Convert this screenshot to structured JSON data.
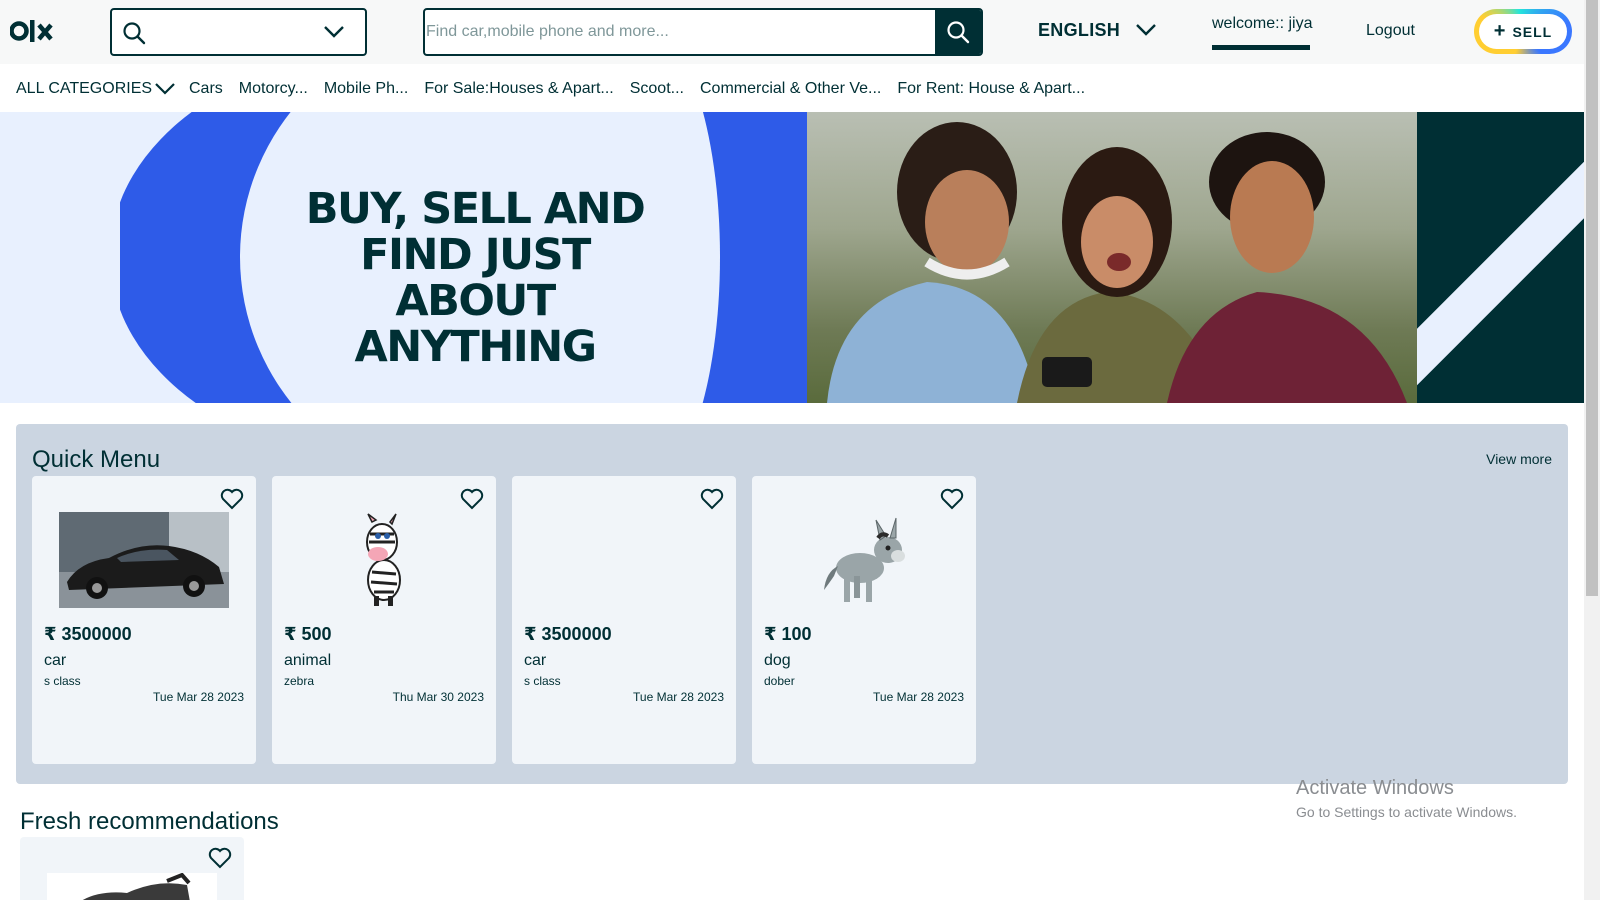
{
  "header": {
    "logo_text": "OLX",
    "location_value": "",
    "search_placeholder": "Find car,mobile phone and more...",
    "language": "ENGLISH",
    "welcome": "welcome:: jiya",
    "logout": "Logout",
    "sell_label": "SELL"
  },
  "nav": {
    "all_categories": "ALL CATEGORIES",
    "links": [
      "Cars",
      "Motorcy...",
      "Mobile Ph...",
      "For Sale:Houses & Apart...",
      "Scoot...",
      "Commercial & Other Ve...",
      "For Rent: House & Apart..."
    ]
  },
  "banner": {
    "line1": "BUY, SELL AND",
    "line2": "FIND JUST ABOUT",
    "line3": "ANYTHING"
  },
  "quick_menu": {
    "title": "Quick Menu",
    "view_more": "View more",
    "cards": [
      {
        "price": "₹ 3500000",
        "category": "car",
        "name": "s class",
        "date": "Tue Mar 28 2023",
        "image": "car"
      },
      {
        "price": "₹ 500",
        "category": "animal",
        "name": "zebra",
        "date": "Thu Mar 30 2023",
        "image": "zebra"
      },
      {
        "price": "₹ 3500000",
        "category": "car",
        "name": "s class",
        "date": "Tue Mar 28 2023",
        "image": "none"
      },
      {
        "price": "₹ 100",
        "category": "dog",
        "name": "dober",
        "date": "Tue Mar 28 2023",
        "image": "donkey"
      }
    ]
  },
  "fresh": {
    "title": "Fresh recommendations"
  },
  "watermark": {
    "line1": "Activate Windows",
    "line2": "Go to Settings to activate Windows."
  },
  "colors": {
    "primary": "#002f34",
    "banner_blue": "#2e5be8",
    "banner_bg": "#e8f0fe",
    "quick_bg": "#cbd5e1",
    "card_bg": "#f1f5f9"
  },
  "icons": [
    "olx-logo-icon",
    "search-icon",
    "chevron-down-icon",
    "heart-icon",
    "plus-icon"
  ]
}
